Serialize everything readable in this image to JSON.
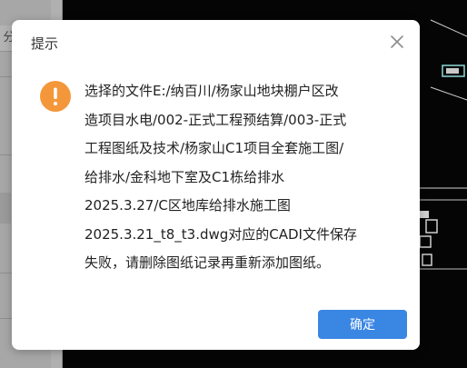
{
  "background_app": {
    "sidebar_tab_label": "分"
  },
  "dialog": {
    "title": "提示",
    "message_lines": [
      "选择的文件E:/纳百川/杨家山地块棚户区改",
      "造项目水电/002-正式工程预结算/003-正式",
      "工程图纸及技术/杨家山C1项目全套施工图/",
      "给排水/金科地下室及C1栋给排水",
      "2025.3.27/C区地库给排水施工图",
      "2025.3.21_t8_t3.dwg对应的CADI文件保存",
      "失败，请删除图纸记录再重新添加图纸。"
    ],
    "ok_button_label": "确定",
    "close_icon": "close-icon",
    "status_icon": "warning-icon"
  },
  "colors": {
    "accent": "#3a86e3",
    "warning": "#f4973a",
    "title_text": "#333333",
    "body_text": "#222222",
    "close_icon": "#8c8c8c"
  }
}
